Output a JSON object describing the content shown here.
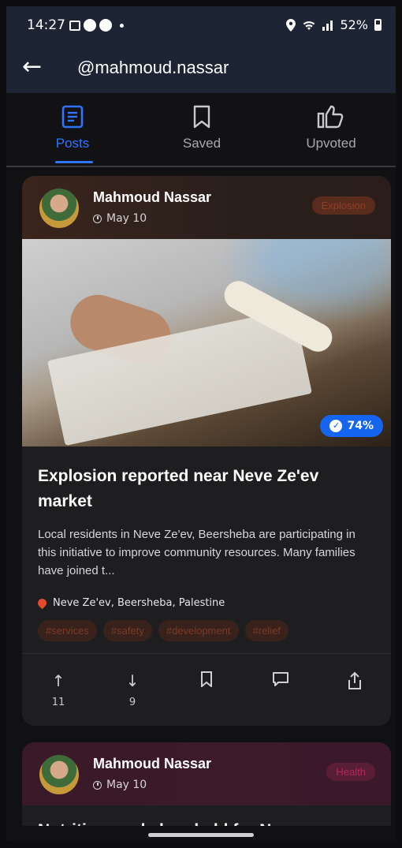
{
  "status": {
    "time": "14:27",
    "battery": "52%",
    "icons": [
      "image-icon",
      "notification-badge-icon",
      "notification-badge-icon",
      "dot-icon",
      "location-icon",
      "wifi-icon",
      "signal-icon",
      "battery-icon"
    ]
  },
  "appbar": {
    "title": "@mahmoud.nassar"
  },
  "tabs": [
    {
      "label": "Posts",
      "icon": "document-icon",
      "active": true
    },
    {
      "label": "Saved",
      "icon": "bookmark-icon",
      "active": false
    },
    {
      "label": "Upvoted",
      "icon": "thumbs-up-icon",
      "active": false
    }
  ],
  "colors": {
    "accent": "#2f73ff",
    "explosion_badge_bg": "#5a2c1e",
    "health_badge_bg": "#5a1d36",
    "confidence_badge": "#1565f0"
  },
  "posts": [
    {
      "author": "Mahmoud Nassar",
      "date": "May 10",
      "category": "Explosion",
      "confidence": "74%",
      "title": "Explosion reported near Neve Ze'ev market",
      "excerpt": "Local residents in Neve Ze'ev, Beersheba are participating in this initiative to improve community resources. Many families have joined t...",
      "location": "Neve Ze'ev, Beersheba, Palestine",
      "tags": [
        "#services",
        "#safety",
        "#development",
        "#relief"
      ],
      "upvotes": "11",
      "downvotes": "9"
    },
    {
      "author": "Mahmoud Nassar",
      "date": "May 10",
      "category": "Health",
      "title": "Nutrition workshop held for Neve"
    }
  ]
}
